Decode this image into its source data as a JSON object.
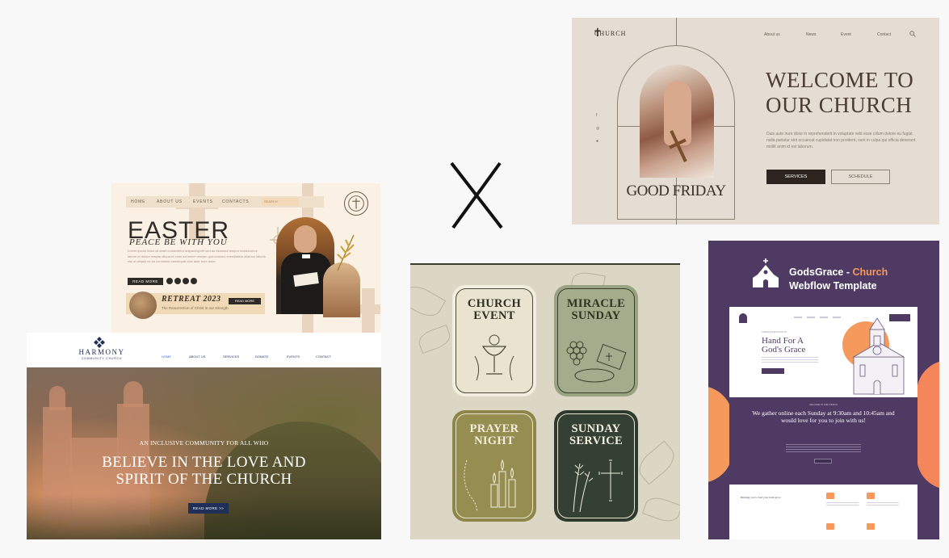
{
  "center_mark": "X",
  "church": {
    "logo": "CHURCH",
    "nav": [
      "About us",
      "News",
      "Event",
      "Contact"
    ],
    "arch_caption": "GOOD FRIDAY",
    "headline_line1": "WELCOME TO",
    "headline_line2": "OUR CHURCH",
    "description": "Duis aute irure dolor in reprehenderit in voluptate velit esse cillum dolore eu fugiat nulla pariatur sint occaecat cupidatat non proident, sunt in culpa qui officia deserunt mollit anim id est laborum.",
    "btn_services": "SERVICES",
    "btn_schedule": "SCHEDULE",
    "social": [
      "f",
      "◎",
      "●"
    ]
  },
  "easter": {
    "nav": [
      "HOME",
      "ABOUT US",
      "EVENTS",
      "CONTACTS"
    ],
    "search_placeholder": "SEARCH",
    "title": "EASTER",
    "subtitle": "PEACE BE WITH YOU",
    "paragraph": "Lorem ipsum dolor sit amet consectetur adipiscing elit sed do eiusmod tempor incididunt ut labore et dolore magna aliqua ut enim ad minim veniam quis nostrud exercitation ullamco laboris nisi ut aliquip ex ea commodo consequat duis aute irure dolor.",
    "read_more": "READ MORE",
    "retreat_title": "RETREAT 2023",
    "retreat_subtitle": "The Resurrection of Christ in our strength",
    "retreat_read_more": "READ MORE"
  },
  "harmony": {
    "logo_name": "HARMONY",
    "logo_sub": "COMMUNITY CHURCH",
    "nav": [
      "HOME",
      "ABOUT US",
      "SERVICES",
      "DONATE",
      "EVENTS",
      "CONTACT"
    ],
    "tagline": "AN INCLUSIVE COMMUNITY FOR ALL WHO",
    "headline_line1": "BELIEVE IN THE LOVE AND",
    "headline_line2": "SPIRIT OF THE CHURCH",
    "cta": "READ MORE >>"
  },
  "events": {
    "cards": [
      {
        "line1": "CHURCH",
        "line2": "EVENT",
        "bg": "#f1eedf",
        "frame": "#e9e4cf",
        "border": "#4a4a35",
        "text": "#2f2f24"
      },
      {
        "line1": "MIRACLE",
        "line2": "SUNDAY",
        "bg": "#9aa381",
        "frame": "#a4ad8b",
        "border": "#3a3f2c",
        "text": "#2f3322"
      },
      {
        "line1": "PRAYER",
        "line2": "NIGHT",
        "bg": "#8e8648",
        "frame": "#968e50",
        "border": "#e9e4cf",
        "text": "#f1eedf"
      },
      {
        "line1": "SUNDAY",
        "line2": "SERVICE",
        "bg": "#2f3a2e",
        "frame": "#354034",
        "border": "#e9e4cf",
        "text": "#f1eedf"
      }
    ]
  },
  "godsgrace": {
    "title_part1": "GodsGrace - ",
    "title_accent": "Church",
    "title_line2": "Webflow Template",
    "mock_eyebrow": "LOREM IPSUM DOLOR SIT",
    "mock_heading_line1": "Hand For A",
    "mock_heading_line2": "God's Grace",
    "band_eyebrow": "WELCOME TO OUR CHURCH",
    "band_heading": "We gather online each Sunday at 9:30am and 10:45am and would love for you to join with us!",
    "low_label": "Helping you to feel your faith grow",
    "accent_color": "#f59a5c",
    "brand_color": "#4f3a63"
  }
}
